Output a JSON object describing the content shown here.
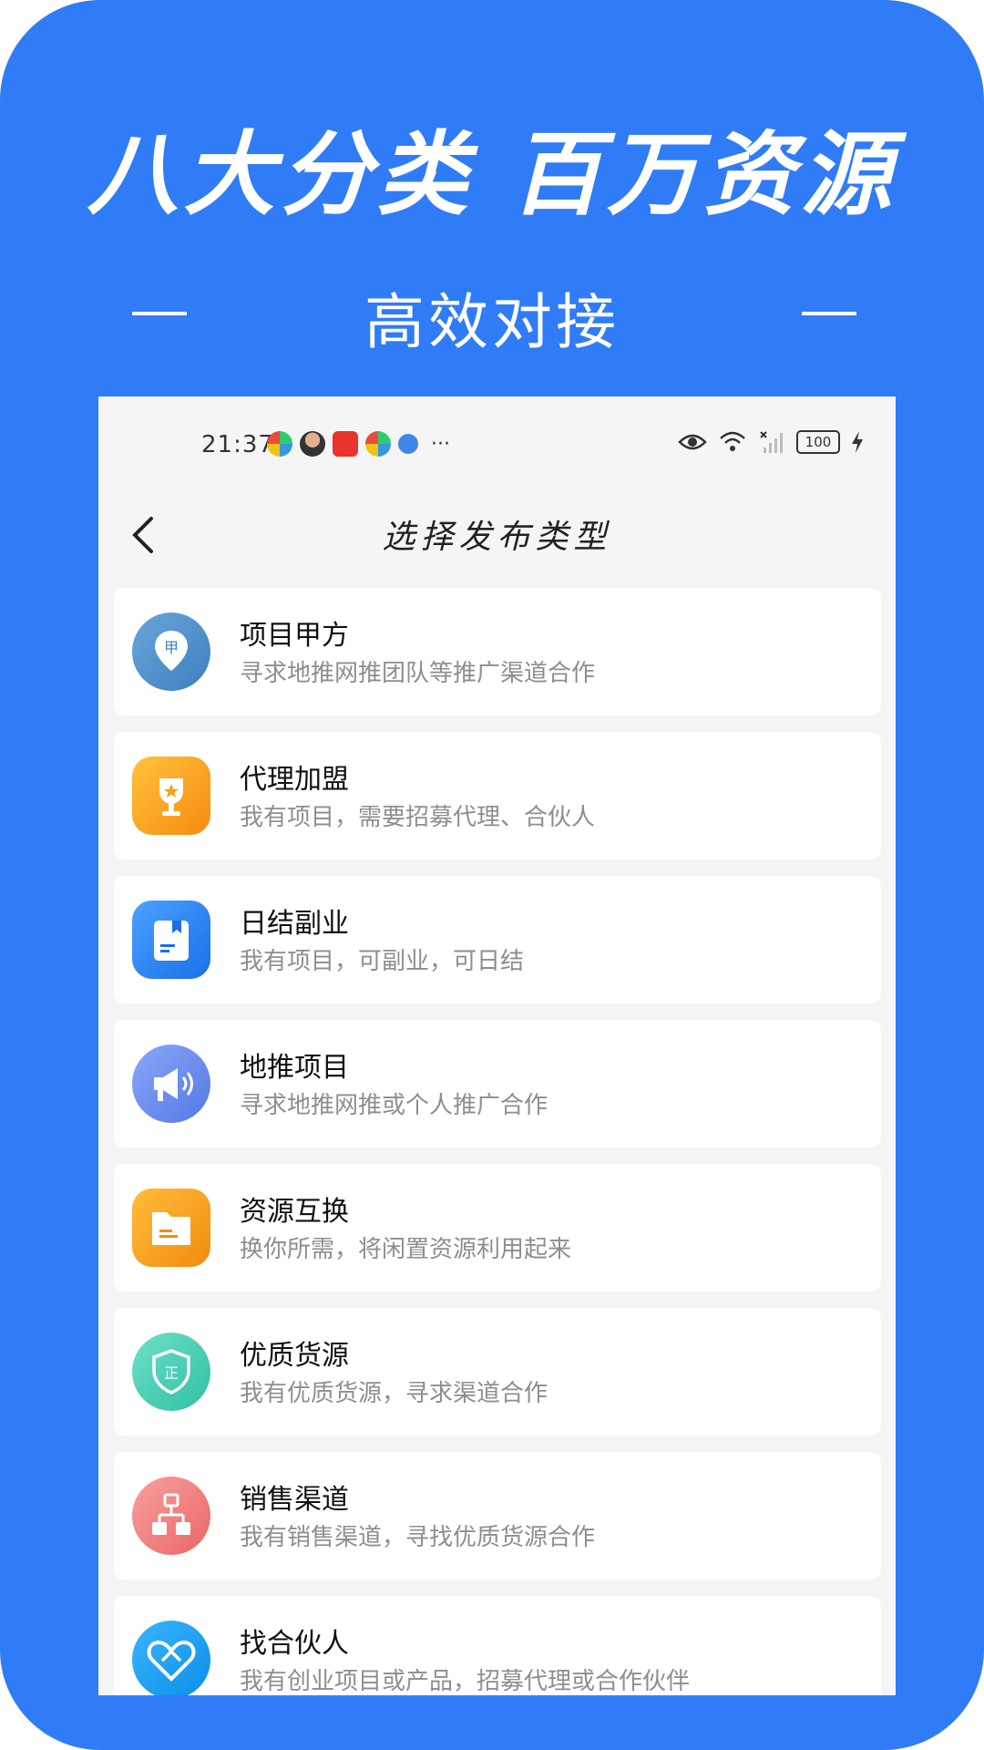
{
  "promo": {
    "title": "八大分类 百万资源",
    "subtitle": "高效对接",
    "bg_color": "#2f7cf6"
  },
  "status_bar": {
    "time": "21:37",
    "battery": "100",
    "notification_icons": [
      "app-icon-1",
      "avatar-icon",
      "huawei-mall-icon",
      "app-icon-2",
      "browser-icon"
    ],
    "more": "···"
  },
  "nav": {
    "title": "选择发布类型",
    "back_icon": "chevron-left-icon"
  },
  "items": [
    {
      "title": "项目甲方",
      "desc": "寻求地推网推团队等推广渠道合作",
      "icon": "map-pin-icon",
      "color": "#4a8bc9"
    },
    {
      "title": "代理加盟",
      "desc": "我有项目，需要招募代理、合伙人",
      "icon": "trophy-icon",
      "color": "#f7a11a"
    },
    {
      "title": "日结副业",
      "desc": "我有项目，可副业，可日结",
      "icon": "book-icon",
      "color": "#2f86f2"
    },
    {
      "title": "地推项目",
      "desc": "寻求地推网推或个人推广合作",
      "icon": "megaphone-icon",
      "color": "#6f8ff0"
    },
    {
      "title": "资源互换",
      "desc": "换你所需，将闲置资源利用起来",
      "icon": "folder-icon",
      "color": "#f6a21d"
    },
    {
      "title": "优质货源",
      "desc": "我有优质货源，寻求渠道合作",
      "icon": "shield-icon",
      "color": "#3fcdb4"
    },
    {
      "title": "销售渠道",
      "desc": "我有销售渠道，寻找优质货源合作",
      "icon": "org-chart-icon",
      "color": "#f07a7a"
    },
    {
      "title": "找合伙人",
      "desc": "我有创业项目或产品，招募代理或合作伙伴",
      "icon": "heart-handshake-icon",
      "color": "#1a9ef0"
    }
  ]
}
